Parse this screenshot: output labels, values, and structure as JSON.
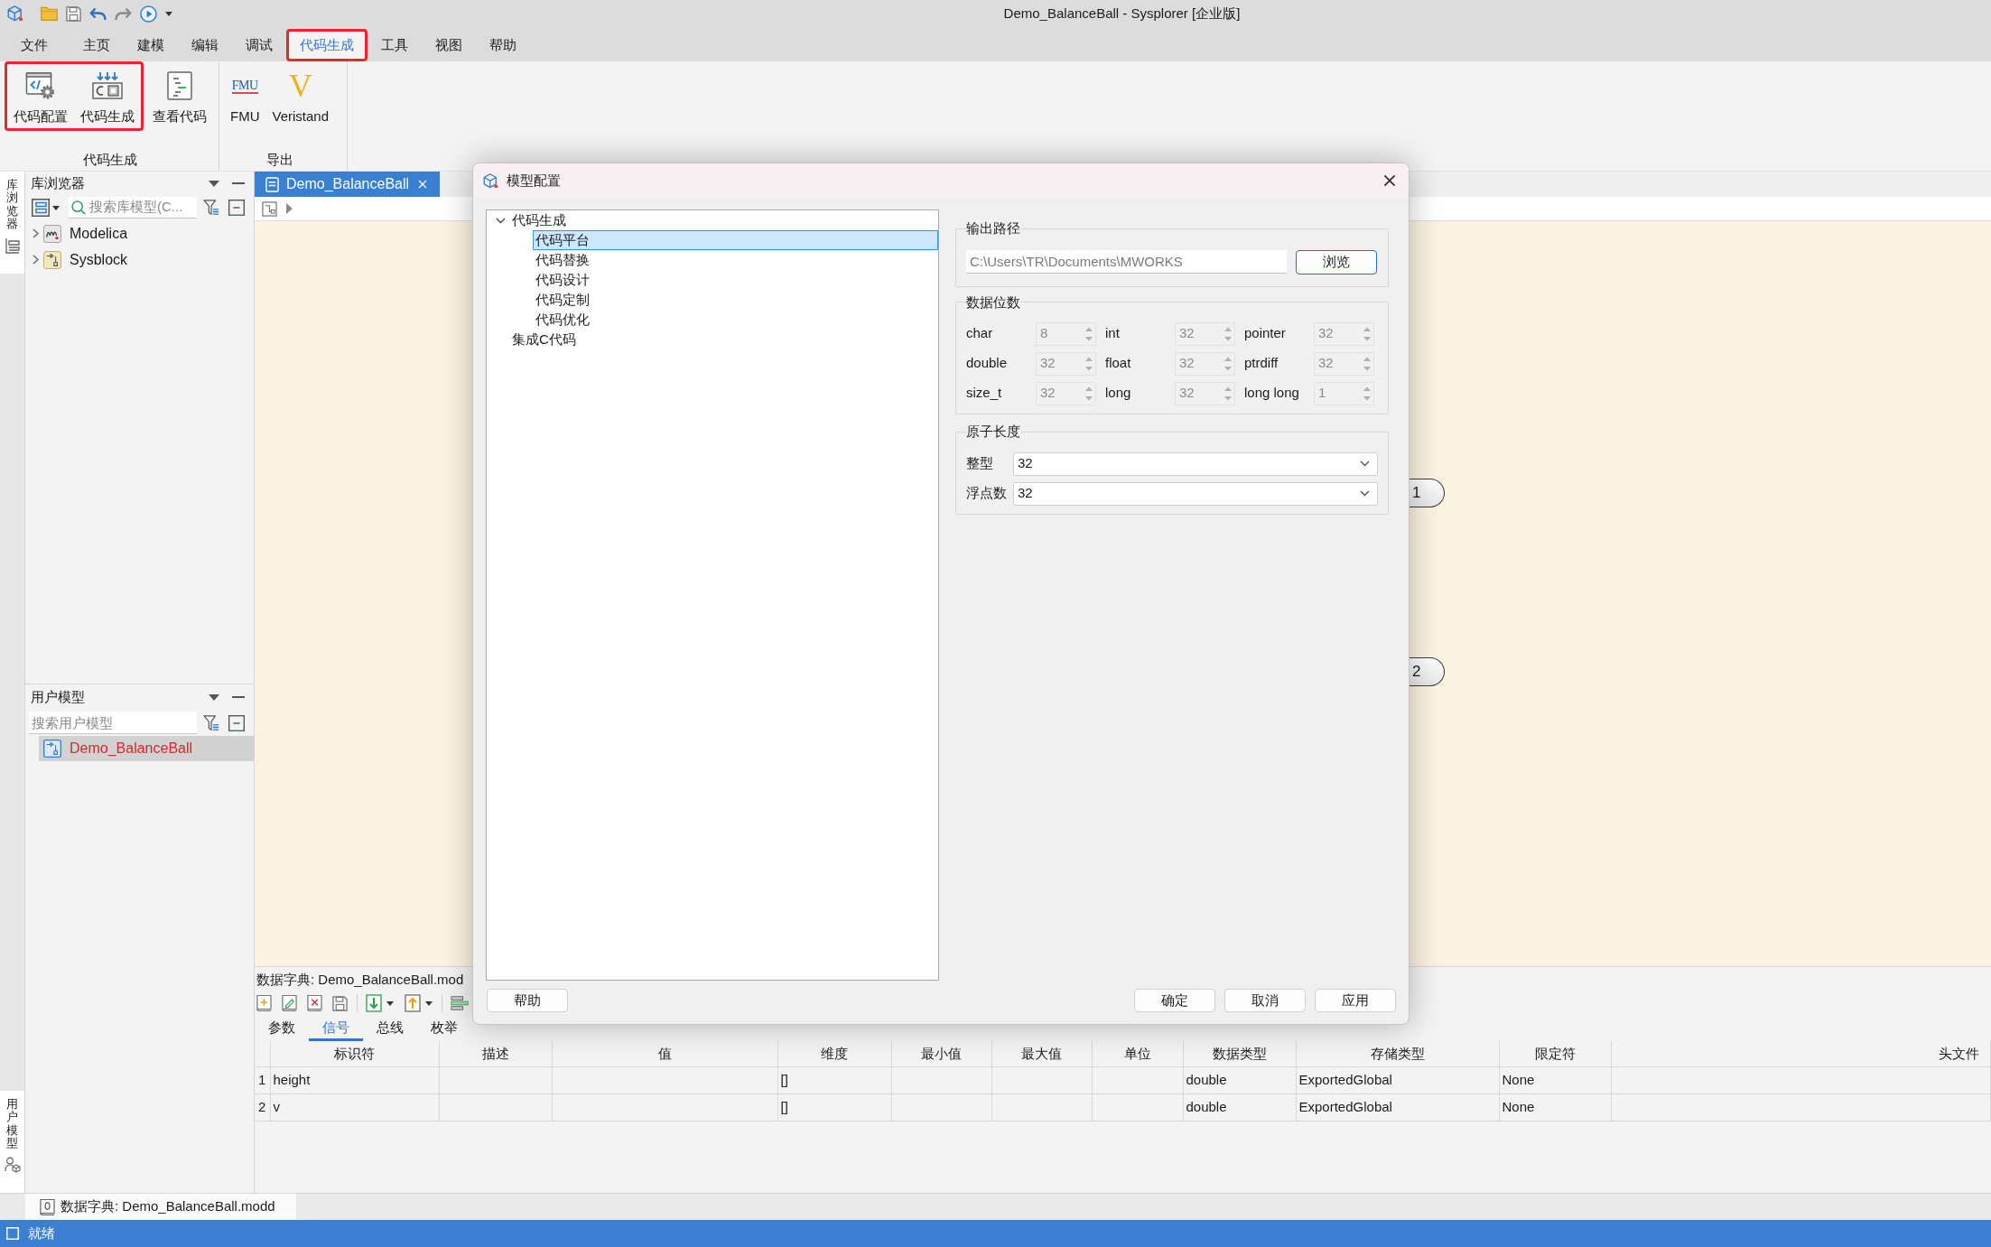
{
  "window": {
    "title": "Demo_BalanceBall - Sysplorer [企业版]"
  },
  "menu": [
    {
      "label": "文件",
      "selected": false,
      "highlighted": false
    },
    {
      "label": "主页",
      "selected": false,
      "highlighted": false
    },
    {
      "label": "建模",
      "selected": false,
      "highlighted": false
    },
    {
      "label": "编辑",
      "selected": false,
      "highlighted": false
    },
    {
      "label": "调试",
      "selected": false,
      "highlighted": false
    },
    {
      "label": "代码生成",
      "selected": true,
      "highlighted": true
    },
    {
      "label": "工具",
      "selected": false,
      "highlighted": false
    },
    {
      "label": "视图",
      "selected": false,
      "highlighted": false
    },
    {
      "label": "帮助",
      "selected": false,
      "highlighted": false
    }
  ],
  "ribbon": {
    "groups": [
      {
        "label": "代码生成",
        "buttons": [
          {
            "label": "代码配置",
            "highlighted": true
          },
          {
            "label": "代码生成",
            "highlighted": true
          },
          {
            "label": "查看代码",
            "highlighted": false
          }
        ]
      },
      {
        "label": "导出",
        "buttons": [
          {
            "label": "FMU",
            "logo": "FMU",
            "highlighted": false
          },
          {
            "label": "Veristand",
            "logo": "V",
            "highlighted": false
          }
        ]
      }
    ]
  },
  "side_tabs": [
    {
      "label": "库浏览器"
    },
    {
      "label": "用户模型"
    }
  ],
  "library_browser": {
    "title": "库浏览器",
    "search": {
      "placeholder": "搜索库模型(C..."
    },
    "tree": [
      {
        "label": "Modelica",
        "expanded": false
      },
      {
        "label": "Sysblock",
        "expanded": false
      }
    ]
  },
  "user_models": {
    "title": "用户模型",
    "search": {
      "placeholder": "搜索用户模型"
    },
    "items": [
      {
        "label": "Demo_BalanceBall",
        "selected": true
      }
    ]
  },
  "document_tabs": [
    {
      "label": "Demo_BalanceBall",
      "selected": true
    }
  ],
  "canvas": {
    "nodes": [
      {
        "label": "1"
      },
      {
        "label": "2"
      }
    ]
  },
  "dialog": {
    "title": "模型配置",
    "tree": [
      {
        "label": "代码生成",
        "selected": false,
        "expanded": true,
        "children": [
          {
            "label": "代码平台",
            "selected": true
          },
          {
            "label": "代码替换",
            "selected": false
          },
          {
            "label": "代码设计",
            "selected": false
          },
          {
            "label": "代码定制",
            "selected": false
          },
          {
            "label": "代码优化",
            "selected": false
          }
        ]
      },
      {
        "label": "集成C代码",
        "selected": false
      }
    ],
    "output_path": {
      "title": "输出路径",
      "value": "C:\\Users\\TR\\Documents\\MWORKS",
      "disabled": true,
      "button": "浏览"
    },
    "data_bits": {
      "title": "数据位数",
      "fields": [
        {
          "label": "char",
          "value": "8",
          "disabled": true
        },
        {
          "label": "int",
          "value": "32",
          "disabled": true
        },
        {
          "label": "pointer",
          "value": "32",
          "disabled": true
        },
        {
          "label": "double",
          "value": "32",
          "disabled": true
        },
        {
          "label": "float",
          "value": "32",
          "disabled": true
        },
        {
          "label": "ptrdiff",
          "value": "32",
          "disabled": true
        },
        {
          "label": "size_t",
          "value": "32",
          "disabled": true
        },
        {
          "label": "long",
          "value": "32",
          "disabled": true
        },
        {
          "label": "long long",
          "value": "1",
          "disabled": true
        }
      ]
    },
    "atomic_length": {
      "title": "原子长度",
      "fields": [
        {
          "label": "整型",
          "value": "32"
        },
        {
          "label": "浮点数",
          "value": "32"
        }
      ]
    },
    "help_button": "帮助",
    "buttons": [
      "确定",
      "取消",
      "应用"
    ]
  },
  "data_dictionary": {
    "title": "数据字典: Demo_BalanceBall.mod",
    "tabs": [
      {
        "label": "参数",
        "selected": false
      },
      {
        "label": "信号",
        "selected": true
      },
      {
        "label": "总线",
        "selected": false
      },
      {
        "label": "枚举",
        "selected": false
      }
    ],
    "table": {
      "columns": [
        "标识符",
        "描述",
        "值",
        "维度",
        "最小值",
        "最大值",
        "单位",
        "数据类型",
        "存储类型",
        "限定符",
        "头文件"
      ],
      "rows": [
        {
          "number": "1",
          "cells": [
            "height",
            null,
            null,
            "[]",
            null,
            null,
            null,
            "double",
            "ExportedGlobal",
            "None",
            null
          ]
        },
        {
          "number": "2",
          "cells": [
            "v",
            null,
            null,
            "[]",
            null,
            null,
            null,
            "double",
            "ExportedGlobal",
            "None",
            null
          ]
        }
      ]
    }
  },
  "bottom_tabs": [
    {
      "label": "数据字典: Demo_BalanceBall.modd",
      "selected": true
    }
  ],
  "status_bar": {
    "text": "就绪"
  }
}
